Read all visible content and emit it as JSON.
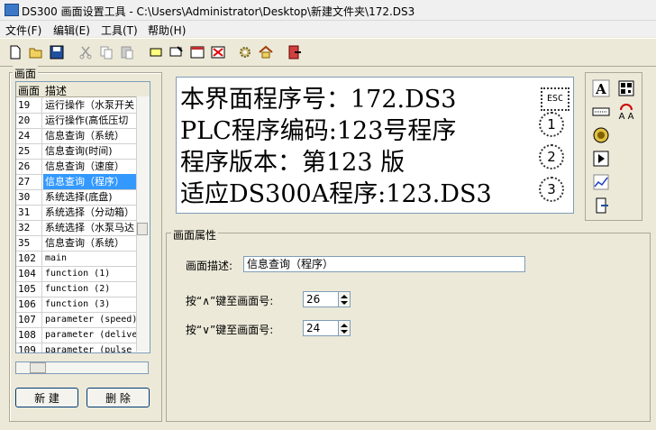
{
  "window": {
    "title": "DS300 画面设置工具 - C:\\Users\\Administrator\\Desktop\\新建文件夹\\172.DS3"
  },
  "menu": {
    "file": "文件(F)",
    "edit": "编辑(E)",
    "tools": "工具(T)",
    "help": "帮助(H)"
  },
  "toolbar": {
    "icons": [
      "new-file-icon",
      "open-folder-icon",
      "save-icon",
      "cut-icon",
      "copy-icon",
      "paste-icon",
      "rectangle-icon",
      "monitor-edit-icon",
      "window-icon",
      "delete-screen-icon",
      "settings-gear-icon",
      "home-icon",
      "exit-icon"
    ]
  },
  "screen_panel": {
    "title": "画面",
    "columns": [
      "画面",
      "描述"
    ],
    "rows": [
      {
        "id": "19",
        "desc": "运行操作（水泵开关"
      },
      {
        "id": "20",
        "desc": "运行操作(高低压切"
      },
      {
        "id": "24",
        "desc": "信息查询（系统）"
      },
      {
        "id": "25",
        "desc": "信息查询(时间)"
      },
      {
        "id": "26",
        "desc": "信息查询（速度）"
      },
      {
        "id": "27",
        "desc": "信息查询（程序）"
      },
      {
        "id": "30",
        "desc": "系统选择(底盘)"
      },
      {
        "id": "31",
        "desc": "系统选择（分动箱）"
      },
      {
        "id": "32",
        "desc": "系统选择（水泵马达"
      },
      {
        "id": "35",
        "desc": "信息查询（系统）"
      },
      {
        "id": "102",
        "desc": "main"
      },
      {
        "id": "104",
        "desc": "function (1)"
      },
      {
        "id": "105",
        "desc": "function (2)"
      },
      {
        "id": "106",
        "desc": "function (3)"
      },
      {
        "id": "107",
        "desc": "parameter (speed)"
      },
      {
        "id": "108",
        "desc": "parameter (delive"
      },
      {
        "id": "109",
        "desc": "parameter (pulse"
      }
    ],
    "selected_row": 5,
    "new_button": "新  建",
    "delete_button": "删  除"
  },
  "preview": {
    "lines": [
      "本界面程序号：172.DS3",
      "PLC程序编码:123号程序",
      "程序版本：第123 版",
      "适应DS300A程序:123.DS3"
    ],
    "esc_label": "ESC",
    "circle_keys": [
      "1",
      "2",
      "3"
    ]
  },
  "right_tools": {
    "icons": [
      "text-A-icon",
      "qr-code-icon",
      "numeric-field-icon",
      "refresh-text-icon",
      "circle-button-icon",
      "play-button-icon",
      "trend-chart-icon",
      "exit-door-icon"
    ]
  },
  "properties": {
    "title": "画面属性",
    "desc_label": "画面描述:",
    "desc_value": "信息查询（程序）",
    "up_label": "按“∧”键至画面号:",
    "up_value": "26",
    "down_label": "按“∨”键至画面号:",
    "down_value": "24"
  }
}
